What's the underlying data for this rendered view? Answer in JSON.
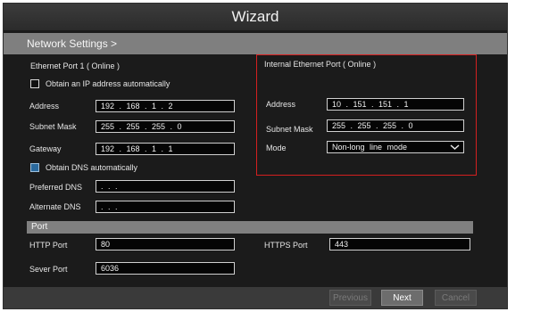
{
  "window": {
    "title": "Wizard"
  },
  "breadcrumb": "Network Settings  >",
  "port1": {
    "heading": "Ethernet Port 1 ( Online )",
    "obtain_ip_label": "Obtain an IP address automatically",
    "obtain_ip_checked": false,
    "address_label": "Address",
    "address_value": "192 . 168 .  1  .  2",
    "subnet_label": "Subnet Mask",
    "subnet_value": "255 . 255 . 255 . 0",
    "gateway_label": "Gateway",
    "gateway_value": "192 . 168 .  1  .  1",
    "obtain_dns_label": "Obtain DNS automatically",
    "obtain_dns_checked": true,
    "preferred_dns_label": "Preferred DNS",
    "preferred_dns_value": "      .      .      .",
    "alternate_dns_label": "Alternate DNS",
    "alternate_dns_value": "      .      .      ."
  },
  "internal": {
    "heading": "Internal Ethernet Port ( Online )",
    "address_label": "Address",
    "address_value": "10 . 151 . 151 . 1",
    "subnet_label": "Subnet Mask",
    "subnet_value": "255 . 255 . 255 . 0",
    "mode_label": "Mode",
    "mode_value": "Non-long line mode"
  },
  "port_section": {
    "title": "Port",
    "http_label": "HTTP Port",
    "http_value": "80",
    "https_label": "HTTPS Port",
    "https_value": "443",
    "server_label": "Sever Port",
    "server_value": "6036"
  },
  "buttons": {
    "previous": "Previous",
    "next": "Next",
    "cancel": "Cancel"
  },
  "colors": {
    "highlight": "#d42020",
    "checked": "#2b6a9e"
  }
}
